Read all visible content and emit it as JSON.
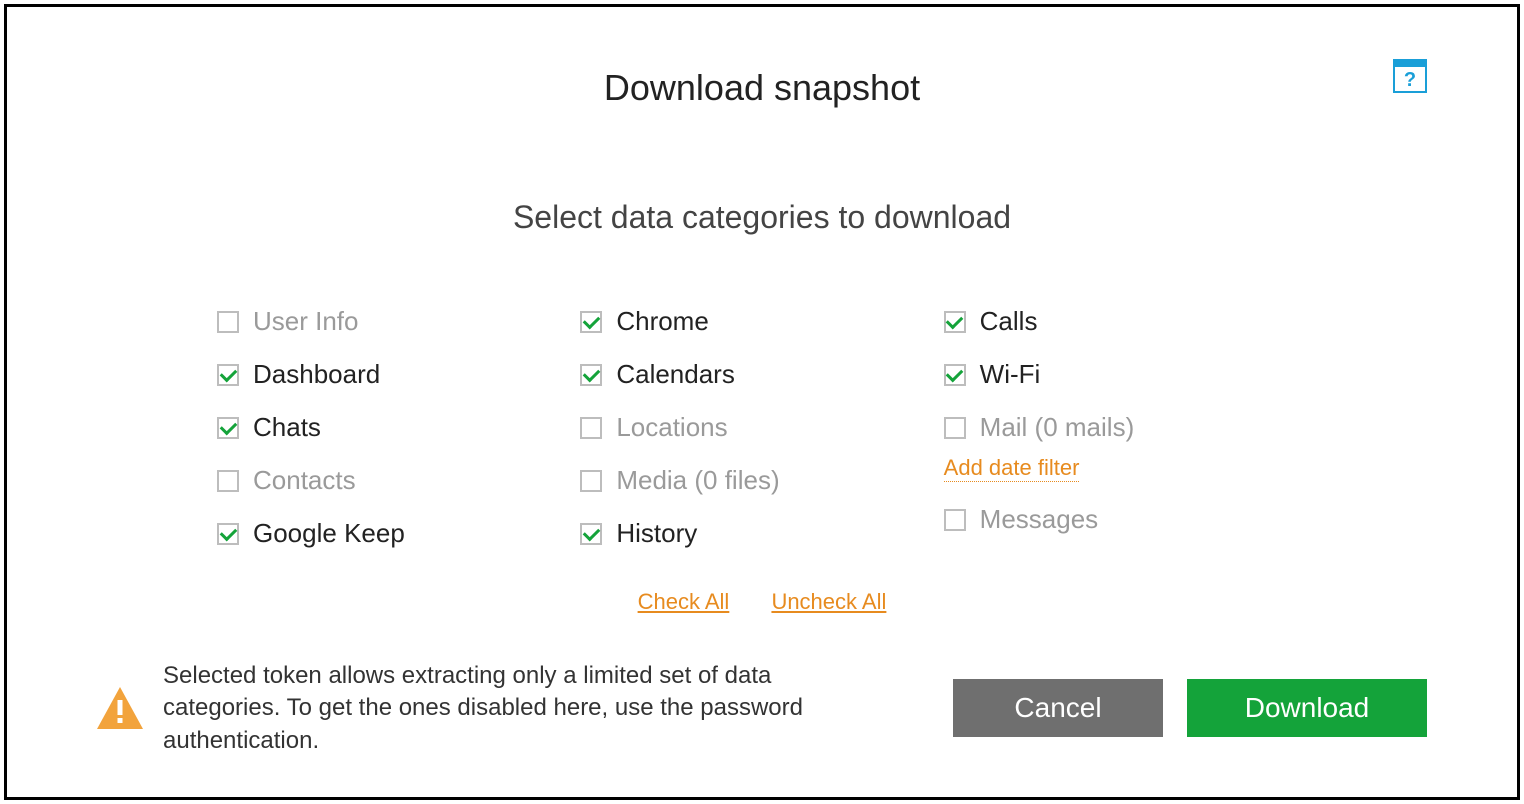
{
  "title": "Download snapshot",
  "subtitle": "Select data categories to download",
  "columns": [
    [
      {
        "label": "User Info",
        "checked": false,
        "enabled": false
      },
      {
        "label": "Dashboard",
        "checked": true,
        "enabled": true
      },
      {
        "label": "Chats",
        "checked": true,
        "enabled": true
      },
      {
        "label": "Contacts",
        "checked": false,
        "enabled": false
      },
      {
        "label": "Google Keep",
        "checked": true,
        "enabled": true
      }
    ],
    [
      {
        "label": "Chrome",
        "checked": true,
        "enabled": true
      },
      {
        "label": "Calendars",
        "checked": true,
        "enabled": true
      },
      {
        "label": "Locations",
        "checked": false,
        "enabled": false
      },
      {
        "label": "Media (0 files)",
        "checked": false,
        "enabled": false
      },
      {
        "label": "History",
        "checked": true,
        "enabled": true
      }
    ],
    [
      {
        "label": "Calls",
        "checked": true,
        "enabled": true
      },
      {
        "label": "Wi-Fi",
        "checked": true,
        "enabled": true
      },
      {
        "label": "Mail (0 mails)",
        "checked": false,
        "enabled": false,
        "dateFilter": true
      },
      {
        "label": "Messages",
        "checked": false,
        "enabled": false
      }
    ]
  ],
  "dateFilterLabel": "Add date filter",
  "links": {
    "checkAll": "Check All",
    "uncheckAll": "Uncheck All"
  },
  "warning": "Selected token allows extracting only a limited set of data categories. To get the ones disabled here, use the password authentication.",
  "buttons": {
    "cancel": "Cancel",
    "download": "Download"
  }
}
